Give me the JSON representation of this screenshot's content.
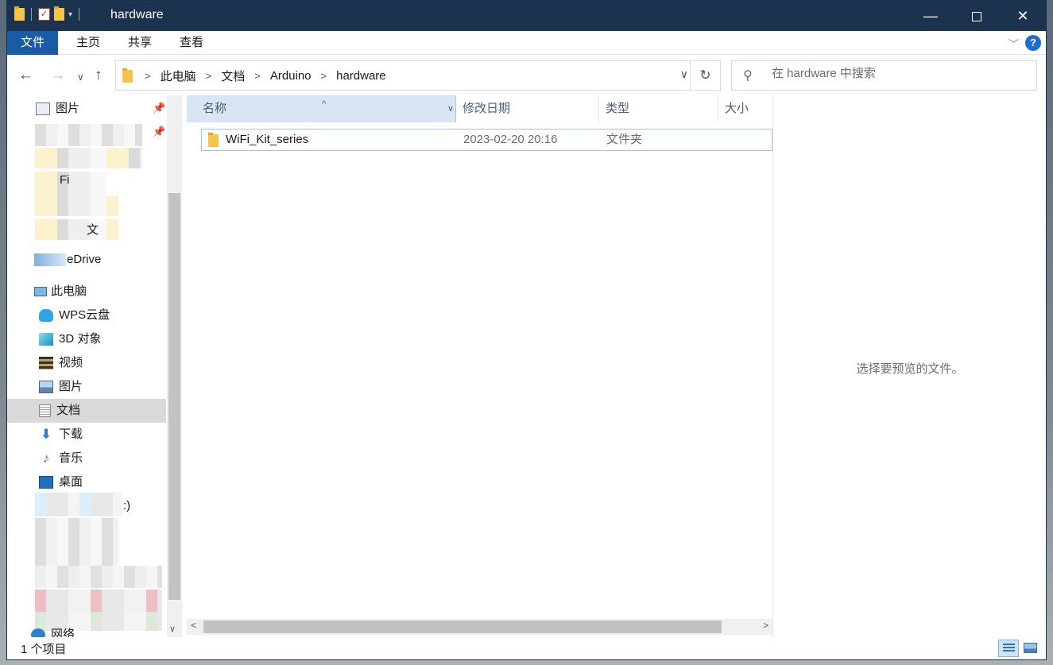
{
  "window": {
    "title": "hardware"
  },
  "window_controls": {
    "minimize": "—",
    "maximize": "",
    "close": "✕"
  },
  "ribbon": {
    "file_tab": "文件",
    "tabs": [
      "主页",
      "共享",
      "查看"
    ],
    "help": "?"
  },
  "address": {
    "crumbs": [
      "此电脑",
      "文档",
      "Arduino",
      "hardware"
    ]
  },
  "search": {
    "placeholder": "在 hardware 中搜索"
  },
  "sidebar": {
    "quick_access_pictures": "图片",
    "onedrive_partial": "eDrive",
    "this_pc": "此电脑",
    "items": [
      {
        "label": "WPS云盘",
        "icon": "cloud-icon"
      },
      {
        "label": "3D 对象",
        "icon": "cube-icon"
      },
      {
        "label": "视频",
        "icon": "film-icon"
      },
      {
        "label": "图片",
        "icon": "picture-icon"
      },
      {
        "label": "文档",
        "icon": "document-icon"
      },
      {
        "label": "下载",
        "icon": "download-arrow-icon"
      },
      {
        "label": "音乐",
        "icon": "music-note-icon"
      },
      {
        "label": "桌面",
        "icon": "desktop-icon"
      }
    ],
    "partial_fragments": [
      "Fi",
      "文",
      ":)"
    ],
    "network_partial": "网络",
    "selected": "文档"
  },
  "columns": {
    "name": "名称",
    "date": "修改日期",
    "type": "类型",
    "size": "大小"
  },
  "files": [
    {
      "name": "WiFi_Kit_series",
      "date": "2023-02-20 20:16",
      "type": "文件夹",
      "size": ""
    }
  ],
  "preview": {
    "message": "选择要预览的文件。"
  },
  "status": {
    "count": "1 个项目"
  },
  "colors": {
    "titlebar": "#1c3350",
    "file_tab": "#1a5ba7",
    "folder": "#f4c54a",
    "selection": "#d8e6f3",
    "help": "#1a6fd1"
  }
}
